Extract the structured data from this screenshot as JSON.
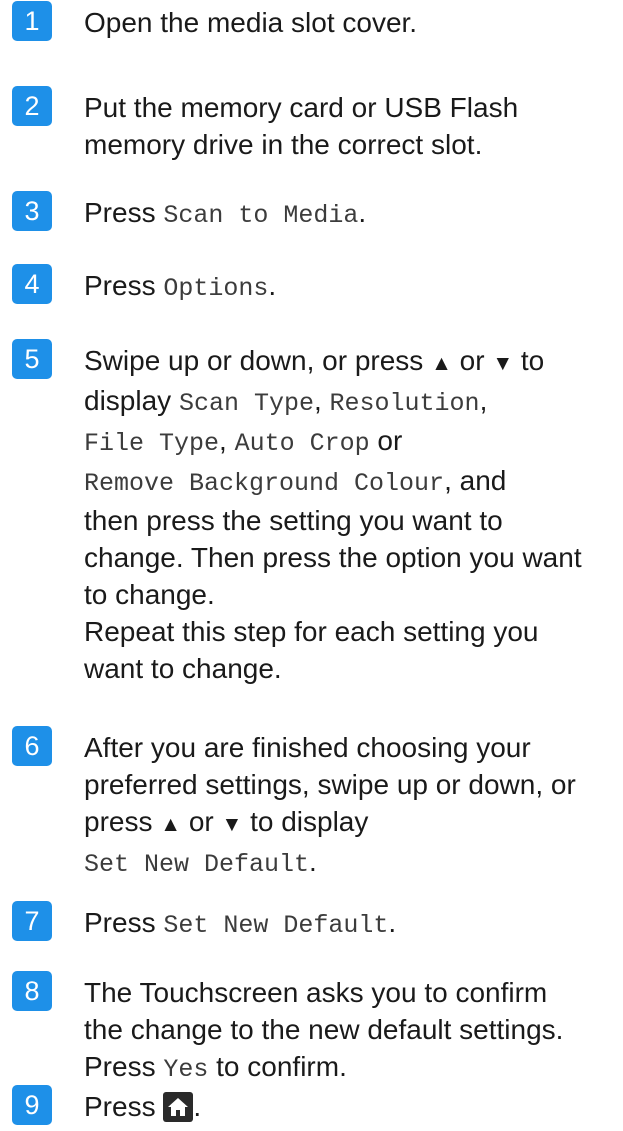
{
  "accent_color": "#1e90e8",
  "steps": [
    {
      "number": "1",
      "parts": {
        "t1": "Open the media slot cover."
      }
    },
    {
      "number": "2",
      "parts": {
        "t1": "Put the memory card or USB Flash",
        "t2": "memory drive in the correct slot."
      }
    },
    {
      "number": "3",
      "parts": {
        "t1": "Press ",
        "m1": "Scan to Media",
        "t2": "."
      }
    },
    {
      "number": "4",
      "parts": {
        "t1": "Press ",
        "m1": "Options",
        "t2": "."
      }
    },
    {
      "number": "5",
      "parts": {
        "t1": "Swipe up or down, or press ",
        "up": "▲",
        "t2": " or ",
        "down": "▼",
        "t3": " to",
        "t4": "display ",
        "m1": "Scan Type",
        "t5": ", ",
        "m2": "Resolution",
        "t6": ",",
        "m3": "File Type",
        "t7": ", ",
        "m4": "Auto Crop",
        "t8": " or",
        "m5": "Remove Background Colour",
        "t9": ", and",
        "t10": "then press the setting you want to",
        "t11": "change. Then press the option you want",
        "t12": "to change.",
        "t13": "Repeat this step for each setting you",
        "t14": "want to change."
      }
    },
    {
      "number": "6",
      "parts": {
        "t1": "After you are finished choosing your",
        "t2": "preferred settings, swipe up or down, or",
        "t3": "press ",
        "up": "▲",
        "t4": " or ",
        "down": "▼",
        "t5": " to display",
        "m1": "Set New Default",
        "t6": "."
      }
    },
    {
      "number": "7",
      "parts": {
        "t1": "Press ",
        "m1": "Set New Default",
        "t2": "."
      }
    },
    {
      "number": "8",
      "parts": {
        "t1": "The Touchscreen asks you to confirm",
        "t2": "the change to the new default settings.",
        "t3": "Press ",
        "m1": "Yes",
        "t4": " to confirm."
      }
    },
    {
      "number": "9",
      "parts": {
        "t1": "Press ",
        "icon": "home-icon",
        "t2": "."
      }
    }
  ]
}
